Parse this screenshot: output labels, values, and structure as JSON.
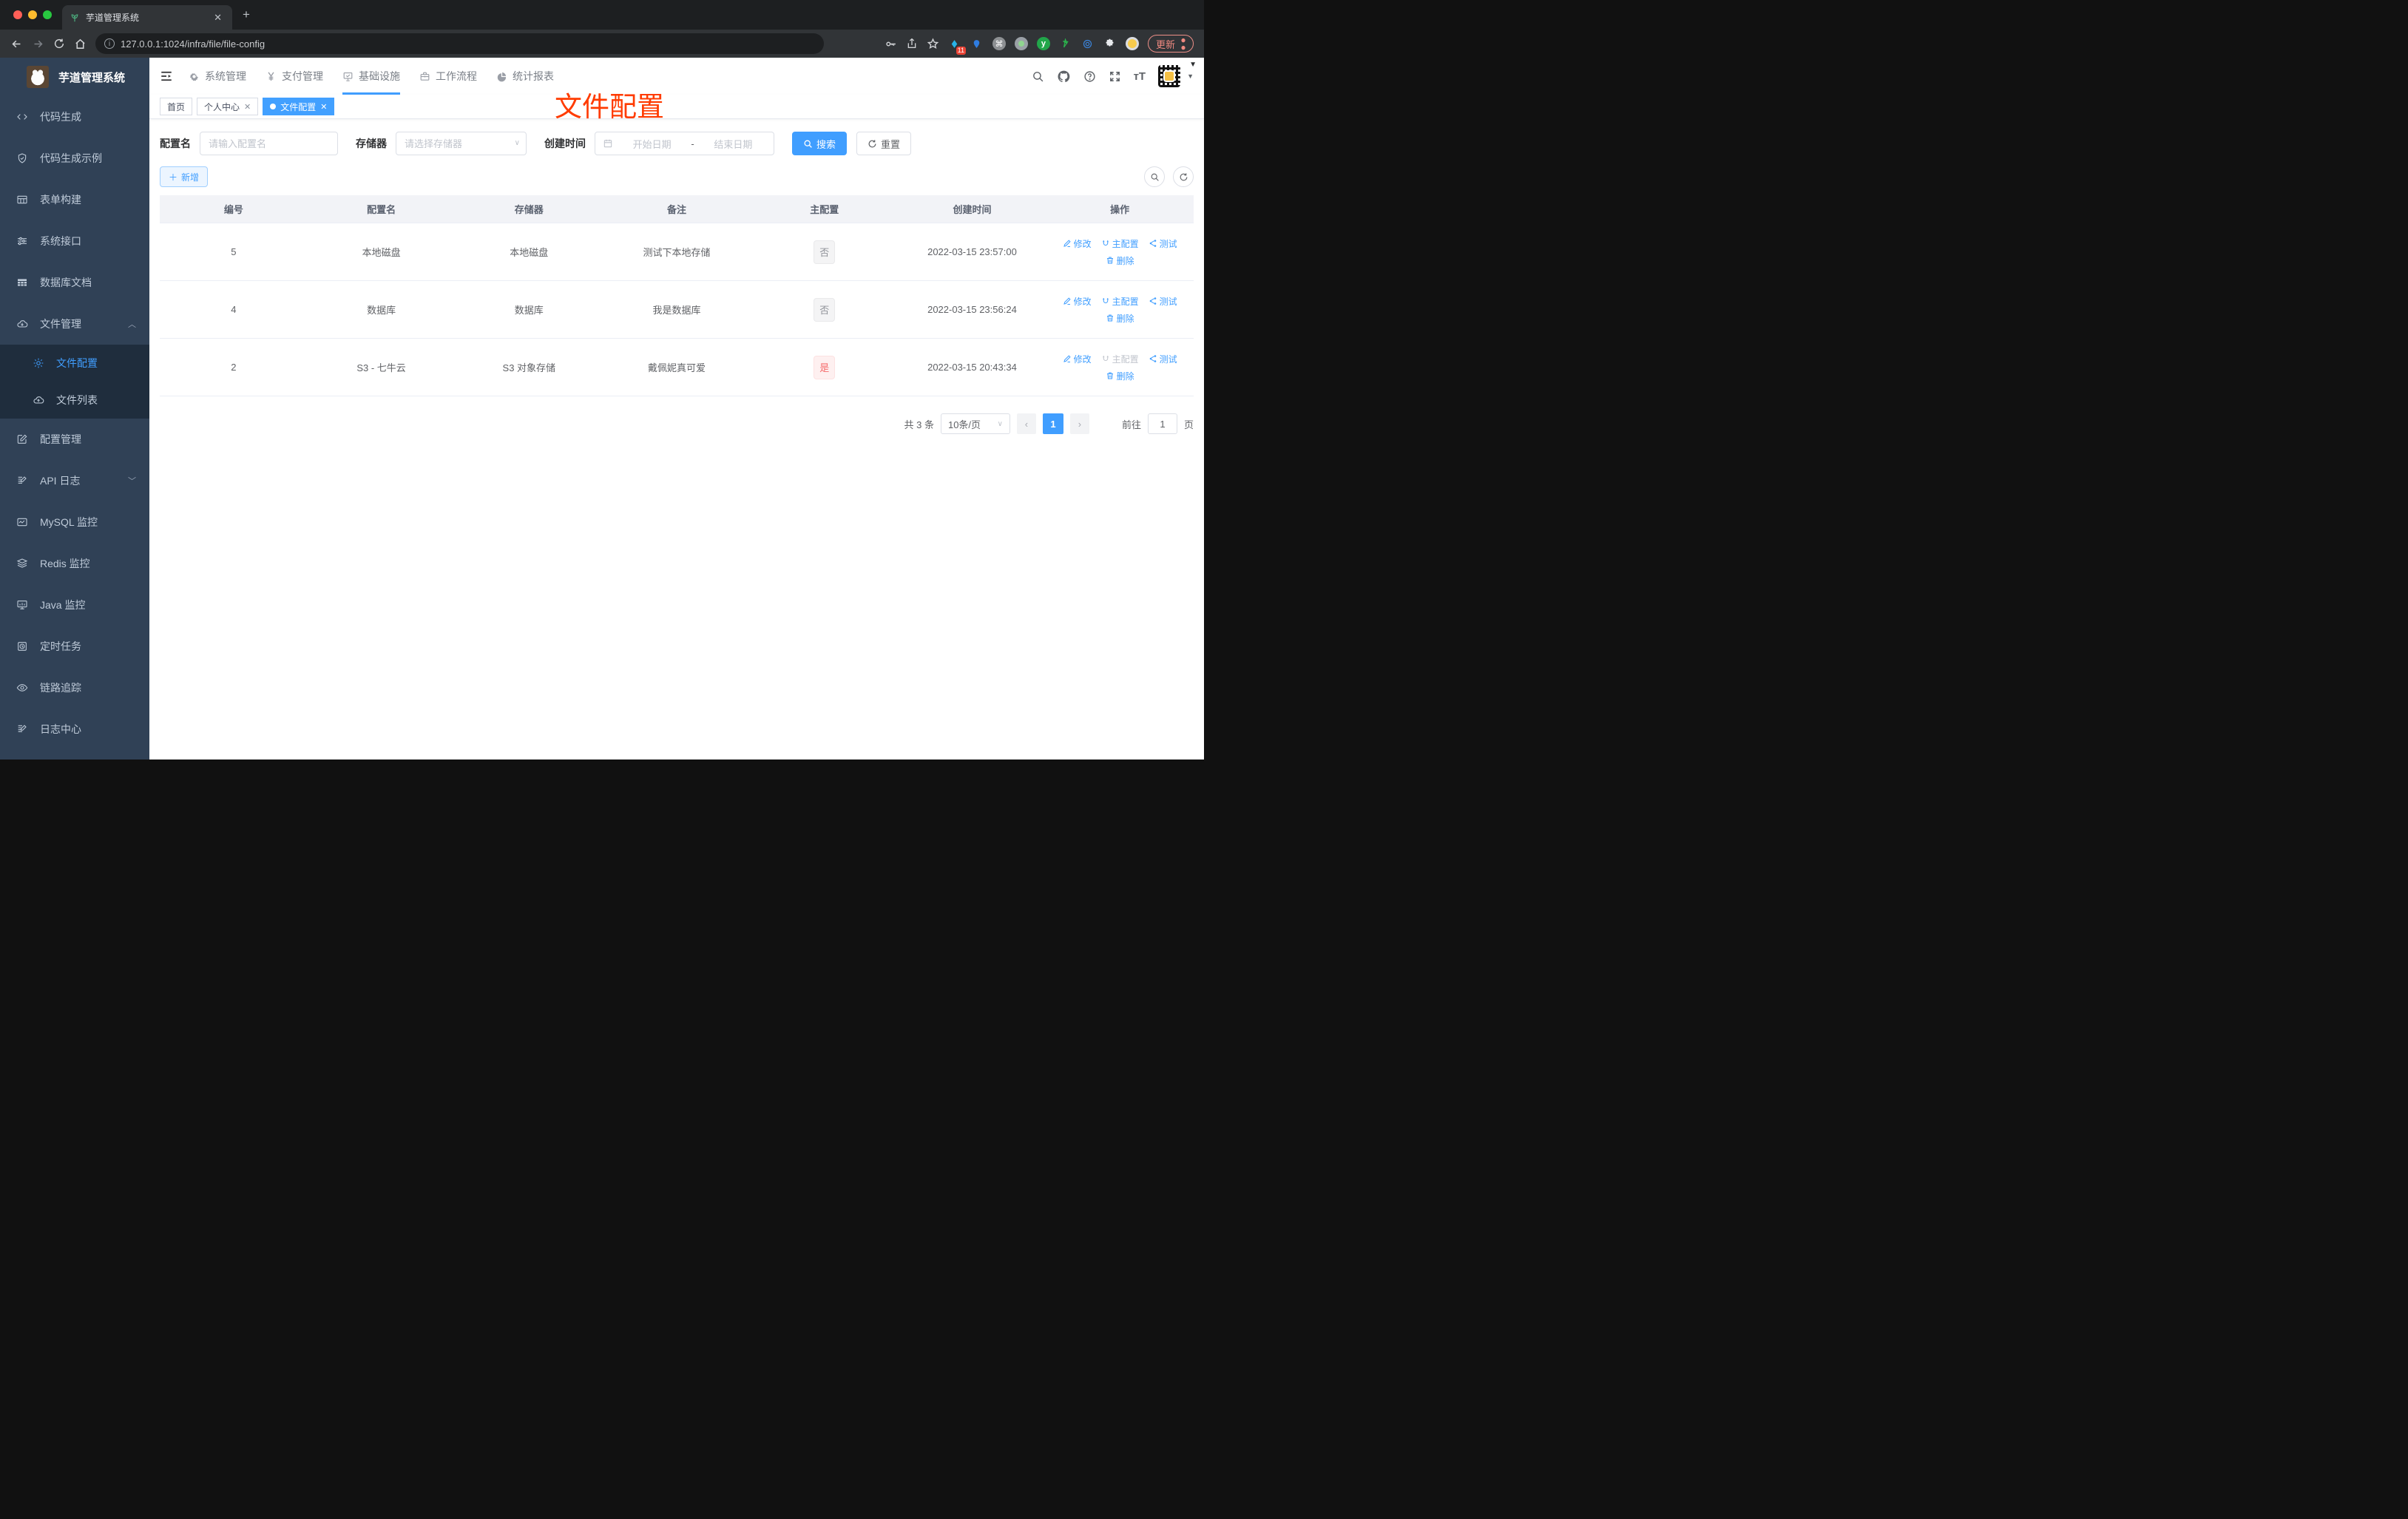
{
  "browser": {
    "tab_title": "芋道管理系统",
    "url": "127.0.0.1:1024/infra/file/file-config",
    "update_label": "更新",
    "extensions_badge": "11"
  },
  "sidebar": {
    "app_title": "芋道管理系统",
    "items": [
      {
        "label": "代码生成"
      },
      {
        "label": "代码生成示例"
      },
      {
        "label": "表单构建"
      },
      {
        "label": "系统接口"
      },
      {
        "label": "数据库文档"
      },
      {
        "label": "文件管理"
      },
      {
        "label": "文件配置"
      },
      {
        "label": "文件列表"
      },
      {
        "label": "配置管理"
      },
      {
        "label": "API 日志"
      },
      {
        "label": "MySQL 监控"
      },
      {
        "label": "Redis 监控"
      },
      {
        "label": "Java 监控"
      },
      {
        "label": "定时任务"
      },
      {
        "label": "链路追踪"
      },
      {
        "label": "日志中心"
      }
    ]
  },
  "topnav": {
    "items": [
      {
        "label": "系统管理"
      },
      {
        "label": "支付管理"
      },
      {
        "label": "基础设施"
      },
      {
        "label": "工作流程"
      },
      {
        "label": "统计报表"
      }
    ]
  },
  "tags": {
    "home": "首页",
    "profile": "个人中心",
    "current": "文件配置"
  },
  "annotation": {
    "text": "文件配置",
    "color": "#ff3b00"
  },
  "filter": {
    "name_label": "配置名",
    "name_placeholder": "请输入配置名",
    "storage_label": "存储器",
    "storage_placeholder": "请选择存储器",
    "date_label": "创建时间",
    "date_start_placeholder": "开始日期",
    "date_separator": "-",
    "date_end_placeholder": "结束日期",
    "search_label": "搜索",
    "reset_label": "重置"
  },
  "toolbar": {
    "add_label": "新增"
  },
  "table": {
    "columns": [
      "编号",
      "配置名",
      "存储器",
      "备注",
      "主配置",
      "创建时间",
      "操作"
    ],
    "actions": {
      "edit": "修改",
      "master": "主配置",
      "test": "测试",
      "delete": "删除"
    },
    "rows": [
      {
        "id": "5",
        "name": "本地磁盘",
        "storage": "本地磁盘",
        "remark": "测试下本地存储",
        "master": "否",
        "created": "2022-03-15 23:57:00"
      },
      {
        "id": "4",
        "name": "数据库",
        "storage": "数据库",
        "remark": "我是数据库",
        "master": "否",
        "created": "2022-03-15 23:56:24"
      },
      {
        "id": "2",
        "name": "S3 - 七牛云",
        "storage": "S3 对象存储",
        "remark": "戴佩妮真可爱",
        "master": "是",
        "created": "2022-03-15 20:43:34"
      }
    ]
  },
  "pagination": {
    "total": "共 3 条",
    "page_size": "10条/页",
    "page": "1",
    "goto_label": "前往",
    "goto_value": "1",
    "unit_label": "页"
  },
  "colors": {
    "accent": "#409eff",
    "danger": "#f56c6c",
    "annotation_red": "#ff3b00",
    "sidebar_bg": "#304156"
  }
}
